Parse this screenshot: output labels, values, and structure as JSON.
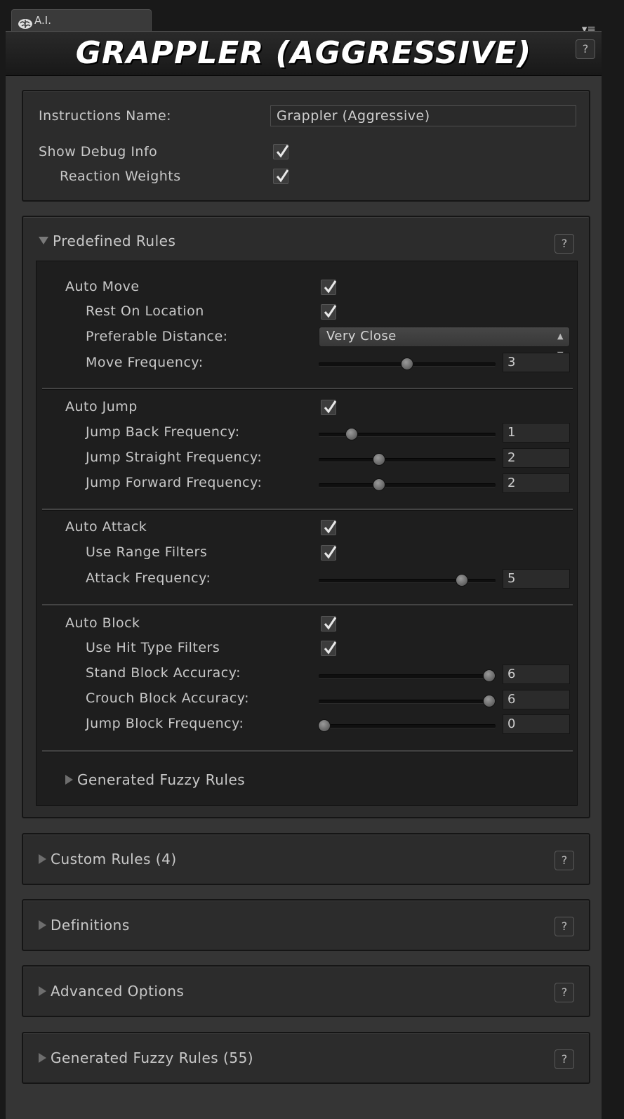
{
  "tab": {
    "label": "A.I.",
    "icon": "brain-icon"
  },
  "tab_menu_glyph": "▾≡",
  "title": "GRAPPLER (AGGRESSIVE)",
  "help_glyph": "?",
  "general": {
    "instructions_name_label": "Instructions Name:",
    "instructions_name_value": "Grappler (Aggressive)",
    "show_debug_label": "Show Debug Info",
    "show_debug_checked": true,
    "reaction_weights_label": "Reaction Weights",
    "reaction_weights_checked": true
  },
  "predefined": {
    "label": "Predefined Rules",
    "expanded": true,
    "auto_move": {
      "label": "Auto Move",
      "checked": true,
      "rest_on_location_label": "Rest On Location",
      "rest_on_location_checked": true,
      "preferable_distance_label": "Preferable Distance:",
      "preferable_distance_value": "Very Close",
      "move_frequency_label": "Move Frequency:",
      "move_frequency_value": "3"
    },
    "auto_jump": {
      "label": "Auto Jump",
      "checked": true,
      "jump_back_label": "Jump Back Frequency:",
      "jump_back_value": "1",
      "jump_straight_label": "Jump Straight Frequency:",
      "jump_straight_value": "2",
      "jump_forward_label": "Jump Forward Frequency:",
      "jump_forward_value": "2"
    },
    "auto_attack": {
      "label": "Auto Attack",
      "checked": true,
      "use_range_filters_label": "Use Range Filters",
      "use_range_filters_checked": true,
      "attack_frequency_label": "Attack Frequency:",
      "attack_frequency_value": "5"
    },
    "auto_block": {
      "label": "Auto Block",
      "checked": true,
      "use_hit_type_label": "Use Hit Type Filters",
      "use_hit_type_checked": true,
      "stand_block_label": "Stand Block Accuracy:",
      "stand_block_value": "6",
      "crouch_block_label": "Crouch Block Accuracy:",
      "crouch_block_value": "6",
      "jump_block_label": "Jump Block Frequency:",
      "jump_block_value": "0"
    },
    "generated_fuzzy_label": "Generated Fuzzy Rules"
  },
  "sections": {
    "custom_rules": "Custom Rules (4)",
    "definitions": "Definitions",
    "advanced_options": "Advanced Options",
    "generated_fuzzy_rules": "Generated Fuzzy Rules (55)"
  },
  "colors": {
    "background": "#191919",
    "panel": "#353535",
    "box": "#2c2c2c",
    "inner": "#1e1e1e",
    "text": "#c8c8c8"
  }
}
